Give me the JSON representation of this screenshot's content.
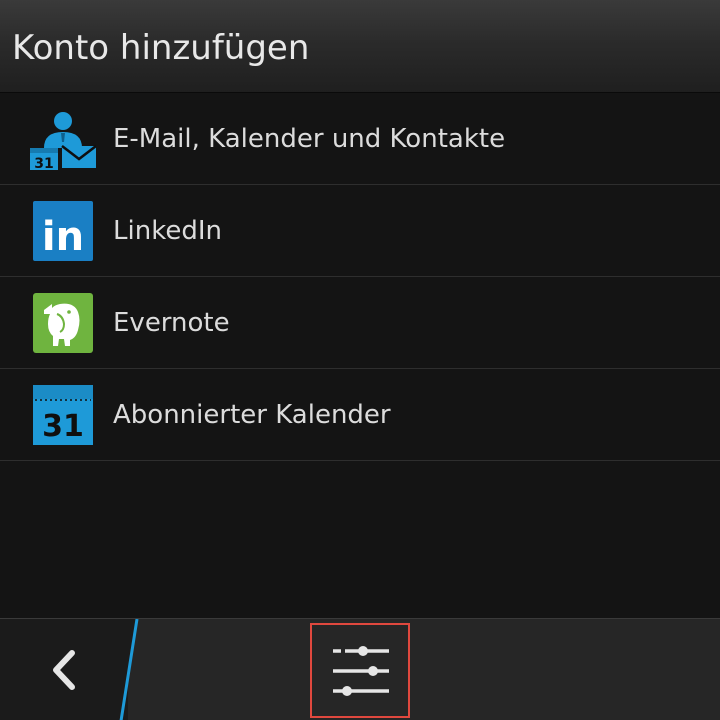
{
  "header": {
    "title": "Konto hinzufügen"
  },
  "accounts": [
    {
      "label": "E-Mail, Kalender und Kontakte",
      "icon": "email-calendar-contacts-icon",
      "calendar_day": "31"
    },
    {
      "label": "LinkedIn",
      "icon": "linkedin-icon",
      "logo_text": "in"
    },
    {
      "label": "Evernote",
      "icon": "evernote-icon"
    },
    {
      "label": "Abonnierter Kalender",
      "icon": "subscribed-calendar-icon",
      "calendar_day": "31"
    }
  ],
  "action_bar": {
    "back_icon": "chevron-left-icon",
    "settings_icon": "sliders-icon"
  },
  "colors": {
    "accent_blue": "#1e9ad8",
    "linkedin_blue": "#1a7fc4",
    "evernote_green": "#6fb43f",
    "highlight_border": "#e0483e"
  }
}
